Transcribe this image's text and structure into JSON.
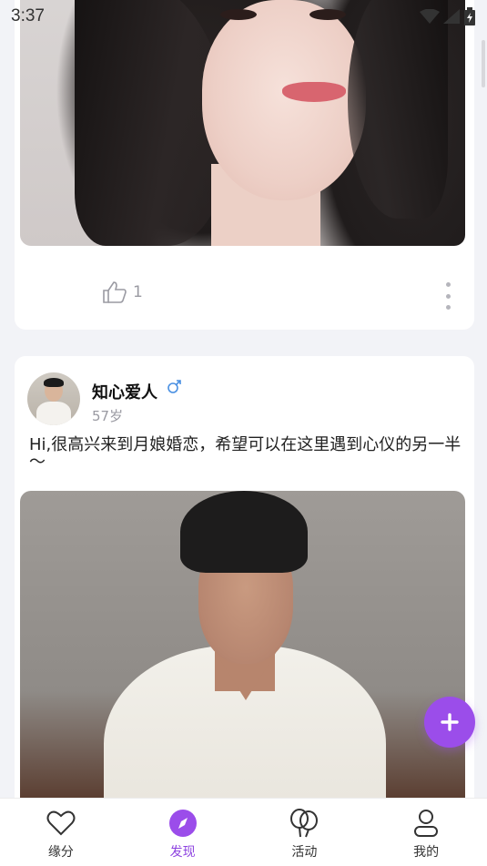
{
  "status_bar": {
    "time": "3:37"
  },
  "feed": {
    "posts": [
      {
        "photo": "woman-portrait",
        "like_count": "1"
      },
      {
        "user_name": "知心爱人",
        "gender": "male",
        "age": "57岁",
        "text": "Hi,很高兴来到月娘婚恋，希望可以在这里遇到心仪的另一半～",
        "photo": "man-portrait"
      }
    ]
  },
  "fab": {
    "icon": "plus-icon"
  },
  "bottom_nav": {
    "items": [
      {
        "label": "缘分",
        "icon": "heart-icon"
      },
      {
        "label": "发现",
        "icon": "compass-icon",
        "active": true
      },
      {
        "label": "活动",
        "icon": "balloons-icon"
      },
      {
        "label": "我的",
        "icon": "user-icon"
      }
    ]
  },
  "colors": {
    "accent": "#9b4dea",
    "active_nav": "#8e44e0",
    "muted": "#9a9aa2"
  }
}
